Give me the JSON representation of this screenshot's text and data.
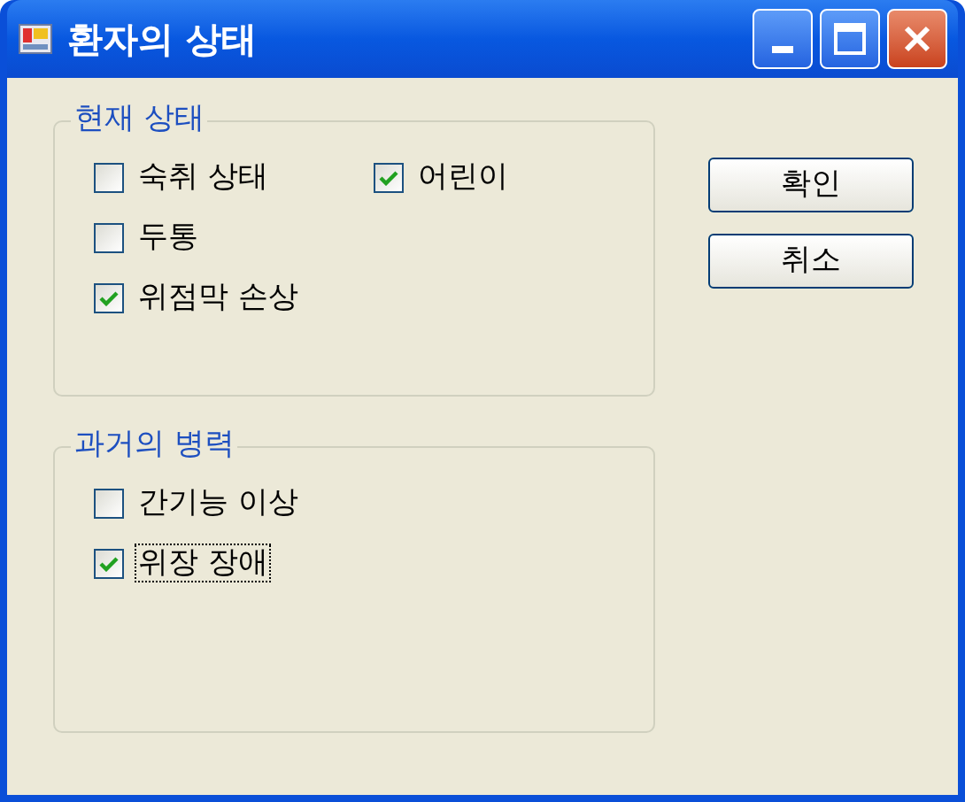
{
  "window": {
    "title": "환자의 상태"
  },
  "groups": [
    {
      "title": "현재 상태",
      "rows": [
        [
          {
            "label": "숙취 상태",
            "checked": false,
            "focused": false
          },
          {
            "label": "어린이",
            "checked": true,
            "focused": false
          }
        ],
        [
          {
            "label": "두통",
            "checked": false,
            "focused": false
          }
        ],
        [
          {
            "label": "위점막 손상",
            "checked": true,
            "focused": false
          }
        ]
      ]
    },
    {
      "title": "과거의 병력",
      "rows": [
        [
          {
            "label": "간기능 이상",
            "checked": false,
            "focused": false
          }
        ],
        [
          {
            "label": "위장 장애",
            "checked": true,
            "focused": true
          }
        ]
      ]
    }
  ],
  "buttons": [
    "확인",
    "취소"
  ]
}
